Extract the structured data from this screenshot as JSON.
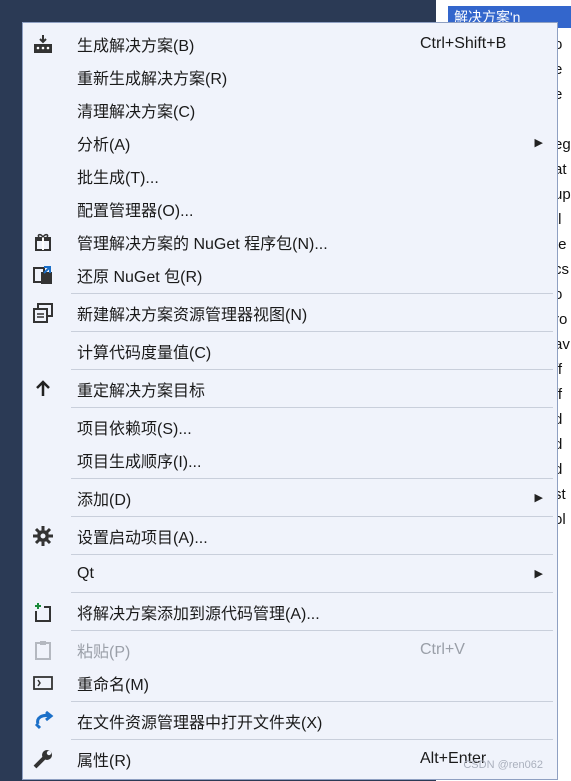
{
  "background": {
    "tab_label": "解决方案'n",
    "editor_fragments": [
      "o",
      "e",
      "e",
      "l",
      "eg",
      "at",
      "up",
      "tl",
      "te",
      "cs",
      "o",
      "ro",
      "av",
      "ff",
      "ff",
      "d",
      "d",
      "d",
      "st",
      "ol"
    ]
  },
  "menu": {
    "items": [
      {
        "label": "生成解决方案(B)",
        "shortcut": "Ctrl+Shift+B",
        "icon": "build-icon"
      },
      {
        "label": "重新生成解决方案(R)"
      },
      {
        "label": "清理解决方案(C)"
      },
      {
        "label": "分析(A)",
        "submenu": true
      },
      {
        "label": "批生成(T)..."
      },
      {
        "label": "配置管理器(O)..."
      },
      {
        "label": "管理解决方案的 NuGet 程序包(N)...",
        "icon": "nuget-gift-icon"
      },
      {
        "label": "还原 NuGet 包(R)",
        "icon": "restore-package-icon"
      },
      {
        "separator": true
      },
      {
        "label": "新建解决方案资源管理器视图(N)",
        "icon": "new-window-icon"
      },
      {
        "separator": true
      },
      {
        "label": "计算代码度量值(C)"
      },
      {
        "separator": true
      },
      {
        "label": "重定解决方案目标",
        "icon": "arrow-up-icon"
      },
      {
        "separator": true
      },
      {
        "label": "项目依赖项(S)..."
      },
      {
        "label": "项目生成顺序(I)..."
      },
      {
        "separator": true
      },
      {
        "label": "添加(D)",
        "submenu": true
      },
      {
        "separator": true
      },
      {
        "label": "设置启动项目(A)...",
        "icon": "gear-icon"
      },
      {
        "separator": true
      },
      {
        "label": "Qt",
        "submenu": true
      },
      {
        "separator": true
      },
      {
        "label": "将解决方案添加到源代码管理(A)...",
        "icon": "add-source-control-icon"
      },
      {
        "separator": true
      },
      {
        "label": "粘贴(P)",
        "shortcut": "Ctrl+V",
        "icon": "paste-icon",
        "disabled": true
      },
      {
        "label": "重命名(M)",
        "icon": "rename-icon"
      },
      {
        "separator": true
      },
      {
        "label": "在文件资源管理器中打开文件夹(X)",
        "icon": "open-folder-arrow-icon"
      },
      {
        "separator": true
      },
      {
        "label": "属性(R)",
        "shortcut": "Alt+Enter",
        "icon": "wrench-icon"
      }
    ]
  },
  "watermark": "CSDN @ren062",
  "colors": {
    "menu_bg": "#f0f3fb",
    "accent": "#3366cc",
    "disabled": "#9a9fa8"
  }
}
